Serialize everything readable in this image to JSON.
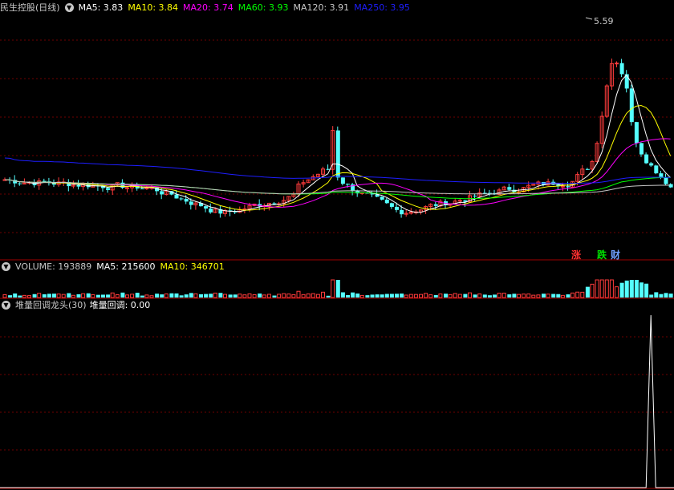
{
  "header": {
    "title": "民生控股(日线)",
    "ma": [
      {
        "label": "MA5: ",
        "value": "3.83",
        "color": "#ffffff"
      },
      {
        "label": "MA10: ",
        "value": "3.84",
        "color": "#ffff00"
      },
      {
        "label": "MA20: ",
        "value": "3.74",
        "color": "#ff00ff"
      },
      {
        "label": "MA60: ",
        "value": "3.93",
        "color": "#00ff00"
      },
      {
        "label": "MA120: ",
        "value": "3.91",
        "color": "#c8c8c8"
      },
      {
        "label": "MA250: ",
        "value": "3.95",
        "color": "#1e1eff"
      }
    ]
  },
  "volume_bar": {
    "label": "VOLUME: ",
    "value": "193889",
    "ma5_label": "MA5: ",
    "ma5_value": "215600",
    "ma10_label": "MA10: ",
    "ma10_value": "346701"
  },
  "indicator_bar": {
    "name": "堆量回调龙头(30)",
    "series_label": "堆量回调: ",
    "series_value": "0.00"
  },
  "peak_label": "5.59",
  "tags": [
    {
      "text": "涨",
      "color": "#ff3030"
    },
    {
      "text": "跌",
      "color": "#00e000"
    },
    {
      "text": "财",
      "color": "#6fa0ff"
    }
  ],
  "colors": {
    "up": "#ff3c3c",
    "down": "#54ffff",
    "grid": "#6e0000",
    "border": "#a00000",
    "bg": "#000000"
  },
  "chart_data": {
    "type": "candlestick",
    "peak_price": 5.59,
    "indicator_peak_index": 132
  }
}
